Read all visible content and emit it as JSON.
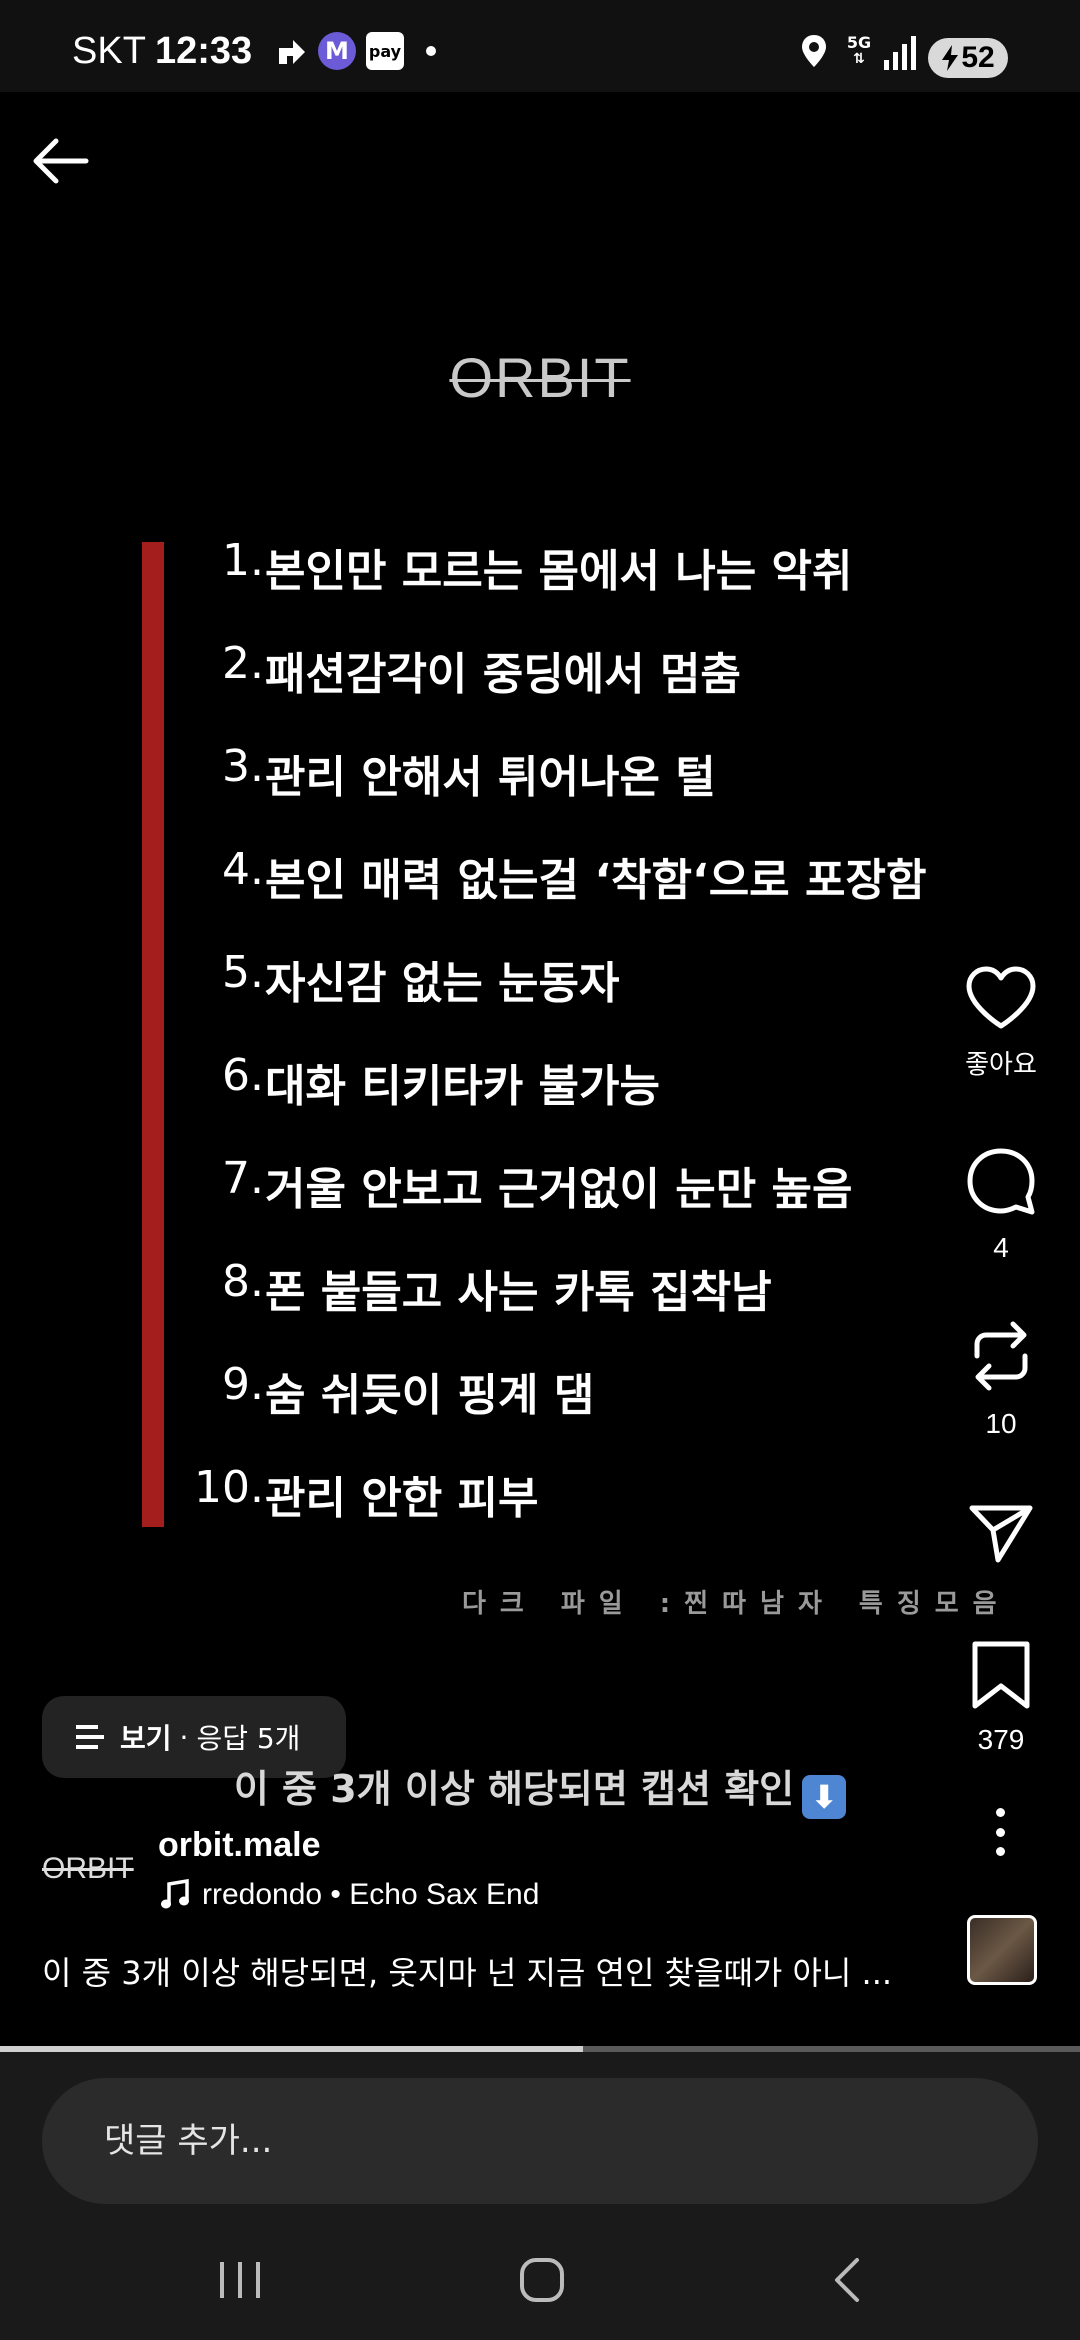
{
  "status_bar": {
    "carrier": "SKT",
    "time": "12:33",
    "network": "5G",
    "battery": "52",
    "icons": [
      "nav-arrow-icon",
      "m-app-icon",
      "pay-icon",
      "notification-dot-icon",
      "location-icon",
      "5g-icon",
      "signal-icon",
      "battery-charging-icon"
    ]
  },
  "post": {
    "logo": "ORBIT",
    "list": [
      {
        "num": "1.",
        "text": "본인만 모르는 몸에서 나는 악취"
      },
      {
        "num": "2.",
        "text": "패션감각이 중딩에서 멈춤"
      },
      {
        "num": "3.",
        "text": "관리 안해서 튀어나온 털"
      },
      {
        "num": "4.",
        "text": "본인 매력 없는걸 ‘착함‘으로 포장함"
      },
      {
        "num": "5.",
        "text": "자신감 없는 눈동자"
      },
      {
        "num": "6.",
        "text": "대화 티키타카 불가능"
      },
      {
        "num": "7.",
        "text": "거울 안보고 근거없이 눈만 높음"
      },
      {
        "num": "8.",
        "text": "폰 붙들고 사는 카톡 집착남"
      },
      {
        "num": "9.",
        "text": "숨 쉬듯이 핑계 댐"
      },
      {
        "num": "10.",
        "text": "관리 안한 피부"
      }
    ],
    "subcaption": "다크 파일 :찐따남자 특징모음",
    "overlay_caption": "이 중 3개 이상 해당되면 캡션 확인",
    "overlay_emoji": "⬇"
  },
  "actions": {
    "like_label": "좋아요",
    "comment_count": "4",
    "repost_count": "10",
    "save_count": "379"
  },
  "replies": {
    "view_label": "보기",
    "separator": "·",
    "count_label": "응답 5개"
  },
  "author": {
    "logo": "ORBIT",
    "username": "orbit.male",
    "music": "rredondo • Echo Sax End",
    "description": "이 중 3개 이상 해당되면, 웃지마 넌 지금 연인 찾을때가 아니 ..."
  },
  "progress": 0.54,
  "comment": {
    "placeholder": "댓글 추가..."
  },
  "colors": {
    "accent_bar": "#a41e1e",
    "background": "#000000"
  }
}
